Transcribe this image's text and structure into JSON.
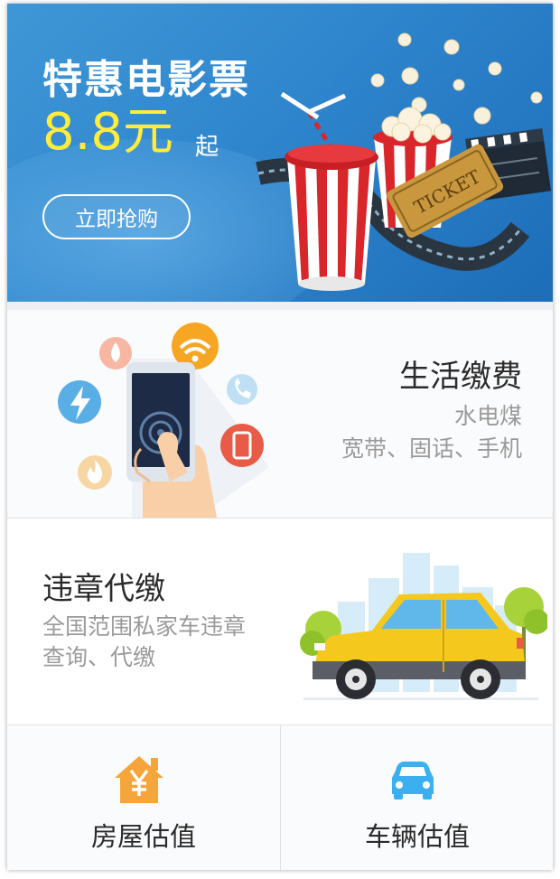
{
  "banner": {
    "title": "特惠电影票",
    "price": "8.8元",
    "price_suffix": "起",
    "cta": "立即抢购",
    "colors": {
      "background": "#2f86cd",
      "price": "#ffec3d"
    },
    "art_icon": "movie-snacks-illustration"
  },
  "life_payment": {
    "title": "生活缴费",
    "subtitle_line1": "水电煤",
    "subtitle_line2": "宽带、固话、手机",
    "art_icon": "phone-in-hand-illustration",
    "bubble_icons": [
      "water-drop-icon",
      "wifi-icon",
      "lightning-icon",
      "telephone-icon",
      "mobile-phone-icon",
      "flame-icon"
    ]
  },
  "violation": {
    "title": "违章代缴",
    "subtitle_line1": "全国范围私家车违章",
    "subtitle_line2": "查询、代缴",
    "art_icon": "yellow-suv-illustration"
  },
  "grid": [
    {
      "label": "房屋估值",
      "icon": "house-yuan-icon",
      "color": "#f5a53a"
    },
    {
      "label": "车辆估值",
      "icon": "car-front-icon",
      "color": "#3cb0ee"
    }
  ]
}
